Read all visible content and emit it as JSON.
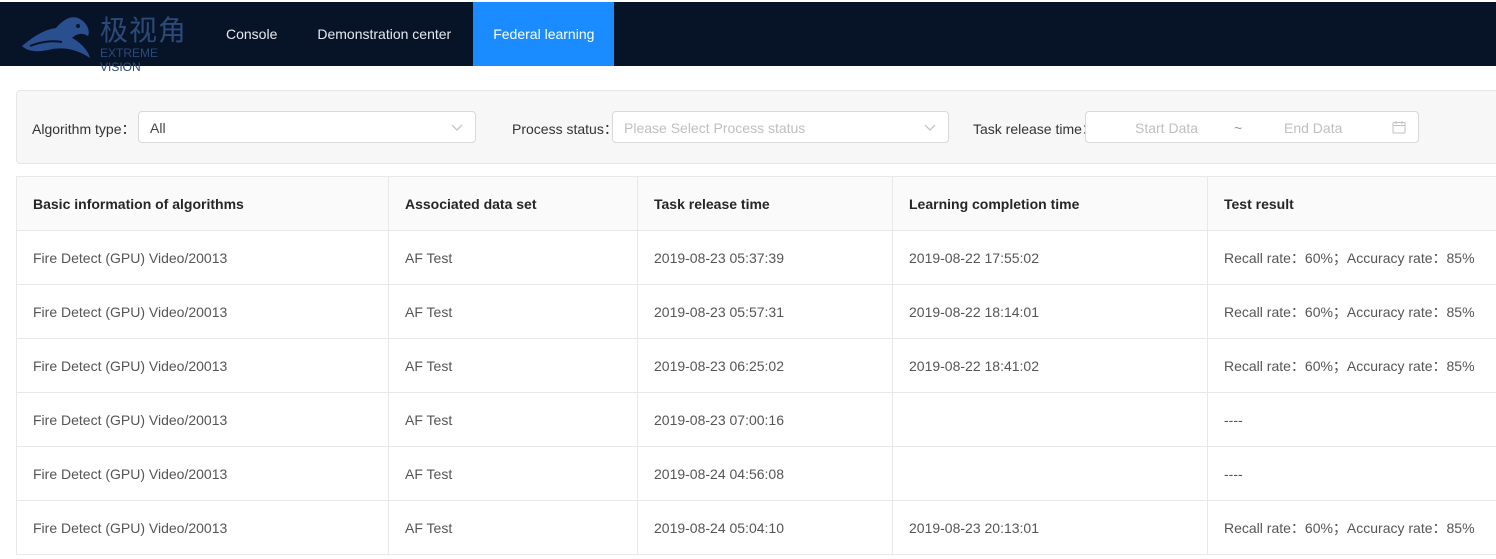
{
  "header": {
    "logo_cn": "极视角",
    "logo_en": "EXTREME VISION",
    "nav": [
      {
        "label": "Console"
      },
      {
        "label": "Demonstration center"
      },
      {
        "label": "Federal learning"
      }
    ],
    "active_nav": "Federal learning",
    "accent_color": "#1a8cff",
    "bg_color": "#071428"
  },
  "filters": {
    "algorithm_type": {
      "label": "Algorithm type：",
      "value": "All"
    },
    "process_status": {
      "label": "Process status：",
      "placeholder": "Please Select Process status"
    },
    "task_release_time": {
      "label": "Task release time：",
      "start_placeholder": "Start Data",
      "separator": "~",
      "end_placeholder": "End Data"
    }
  },
  "table": {
    "columns": [
      "Basic information of algorithms",
      "Associated data set",
      "Task release time",
      "Learning completion time",
      "Test result"
    ],
    "rows": [
      [
        "Fire Detect (GPU) Video/20013",
        "AF Test",
        "2019-08-23 05:37:39",
        "2019-08-22 17:55:02",
        "Recall rate：60%；Accuracy rate：85%"
      ],
      [
        "Fire Detect (GPU) Video/20013",
        "AF Test",
        "2019-08-23 05:57:31",
        "2019-08-22 18:14:01",
        "Recall rate：60%；Accuracy rate：85%"
      ],
      [
        "Fire Detect (GPU) Video/20013",
        "AF Test",
        "2019-08-23 06:25:02",
        "2019-08-22 18:41:02",
        "Recall rate：60%；Accuracy rate：85%"
      ],
      [
        "Fire Detect (GPU) Video/20013",
        "AF Test",
        "2019-08-23 07:00:16",
        "",
        "----"
      ],
      [
        "Fire Detect (GPU) Video/20013",
        "AF Test",
        "2019-08-24 04:56:08",
        "",
        "----"
      ],
      [
        "Fire Detect (GPU) Video/20013",
        "AF Test",
        "2019-08-24 05:04:10",
        "2019-08-23 20:13:01",
        "Recall rate：60%；Accuracy rate：85%"
      ]
    ]
  }
}
